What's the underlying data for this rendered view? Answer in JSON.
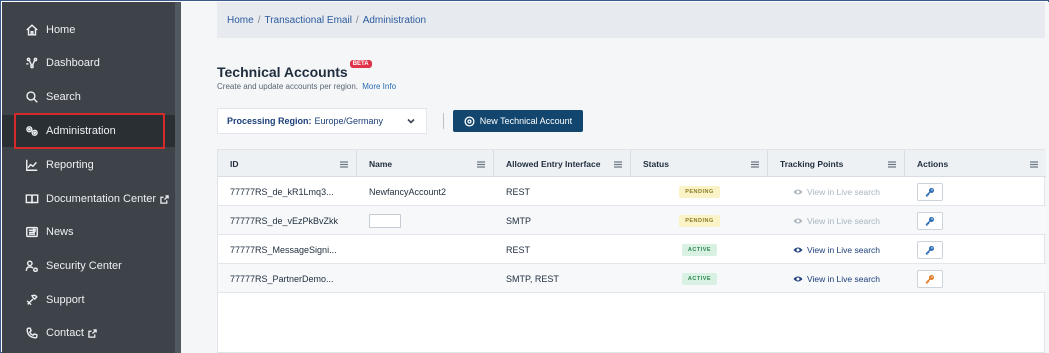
{
  "sidebar": {
    "items": [
      {
        "label": "Home",
        "icon": "home-icon",
        "external": false
      },
      {
        "label": "Dashboard",
        "icon": "dashboard-icon",
        "external": false
      },
      {
        "label": "Search",
        "icon": "search-icon",
        "external": false
      },
      {
        "label": "Administration",
        "icon": "administration-icon",
        "external": false
      },
      {
        "label": "Reporting",
        "icon": "reporting-icon",
        "external": false
      },
      {
        "label": "Documentation Center",
        "icon": "book-icon",
        "external": true
      },
      {
        "label": "News",
        "icon": "news-icon",
        "external": false
      },
      {
        "label": "Security Center",
        "icon": "security-icon",
        "external": false
      },
      {
        "label": "Support",
        "icon": "support-icon",
        "external": false
      },
      {
        "label": "Contact",
        "icon": "contact-icon",
        "external": true
      }
    ],
    "active_item": "Administration"
  },
  "breadcrumb": {
    "items": [
      "Home",
      "Transactional Email",
      "Administration"
    ],
    "separator": "/"
  },
  "page": {
    "title": "Technical Accounts",
    "badge": "BETA",
    "subtitle": "Create and update accounts per region.",
    "more_info": "More Info"
  },
  "region": {
    "label": "Processing Region:",
    "value": "Europe/Germany"
  },
  "new_account_button": "New Technical Account",
  "table": {
    "columns": [
      "ID",
      "Name",
      "Allowed Entry Interface",
      "Status",
      "Tracking Points",
      "Actions"
    ],
    "rows": [
      {
        "id": "77777RS_de_kR1Lmq3...",
        "name": "NewfancyAccount2",
        "interface": "REST",
        "status": "PENDING",
        "tracking": "View in Live search",
        "tracking_enabled": false,
        "action_icon": "key-icon"
      },
      {
        "id": "77777RS_de_vEzPkBvZkk",
        "name": "",
        "interface": "SMTP",
        "status": "PENDING",
        "tracking": "View in Live search",
        "tracking_enabled": false,
        "action_icon": "key-icon"
      },
      {
        "id": "77777RS_MessageSigni...",
        "name": "",
        "interface": "REST",
        "status": "ACTIVE",
        "tracking": "View in Live search",
        "tracking_enabled": true,
        "action_icon": "key-icon"
      },
      {
        "id": "77777RS_PartnerDemo...",
        "name": "",
        "interface": "SMTP, REST",
        "status": "ACTIVE",
        "tracking": "View in Live search",
        "tracking_enabled": true,
        "action_icon": "key-icon"
      }
    ]
  },
  "colors": {
    "sidebar_bg": "#3d4348",
    "primary_button": "#12466e",
    "highlight_border": "#d42a2a",
    "beta_badge": "#e0334a",
    "pending_bg": "#faf3c8",
    "active_bg": "#d9f1e2",
    "key_blue": "#2b6cb3",
    "key_orange": "#e07b24"
  }
}
